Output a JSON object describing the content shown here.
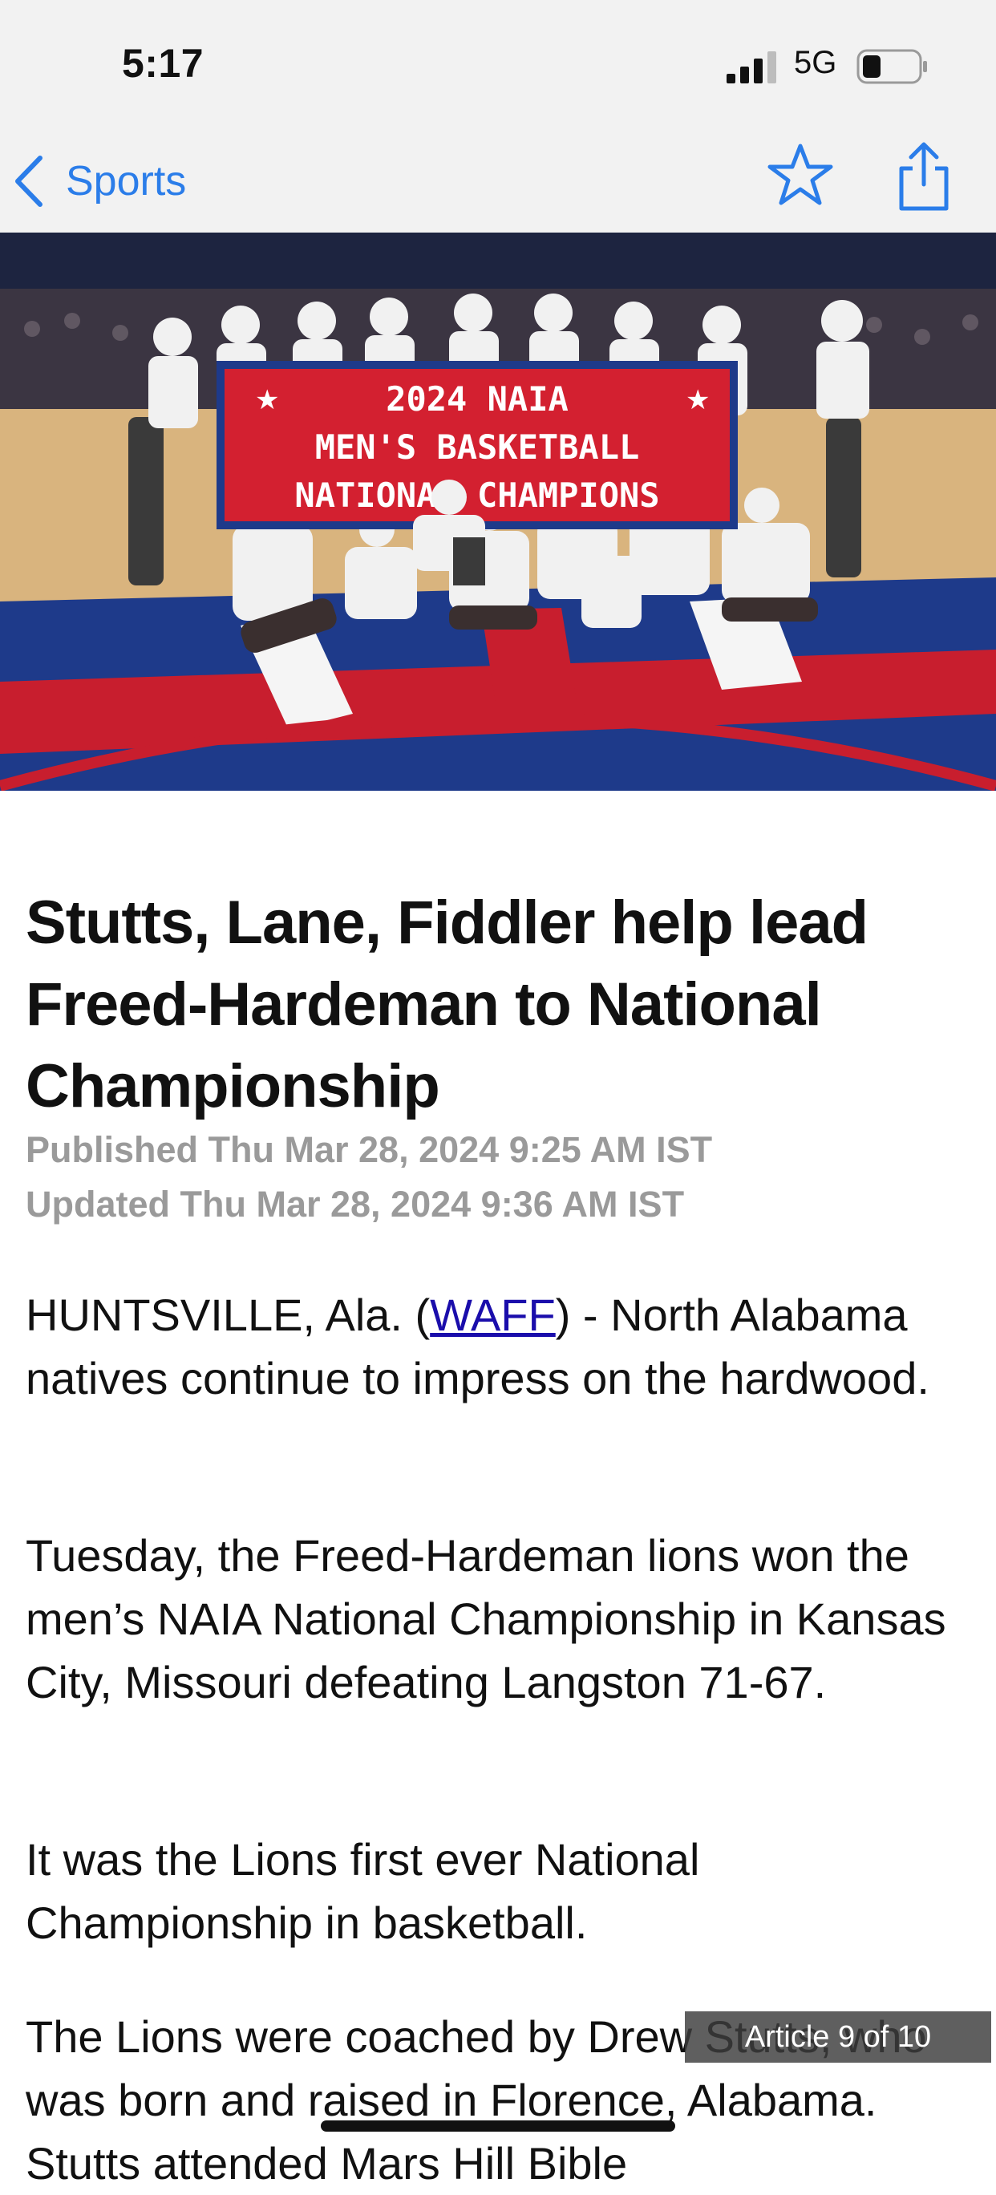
{
  "status_bar": {
    "time": "5:17",
    "network": "5G"
  },
  "nav": {
    "back_label": "Sports"
  },
  "hero": {
    "banner_line1": "2024 NAIA",
    "banner_line2": "MEN'S BASKETBALL",
    "banner_line3": "NATIONAL CHAMPIONS"
  },
  "article": {
    "headline": "Stutts, Lane, Fiddler help lead Freed-Hardeman to National Championship",
    "published": "Published Thu Mar 28, 2024 9:25 AM IST",
    "updated": "Updated Thu Mar 28, 2024 9:36 AM IST",
    "p1_prefix": "HUNTSVILLE, Ala. (",
    "p1_link": "WAFF",
    "p1_suffix": ") - North Alabama natives continue to impress on the hardwood.",
    "p2": "Tuesday, the Freed-Hardeman lions won the men’s NAIA National Championship in Kansas City, Missouri defeating Langston 71-67.",
    "p3": "It was the Lions first ever National Championship in basketball.",
    "p4": "The Lions were coached by Drew Stutts, who was born and raised in Florence, Alabama. Stutts attended Mars Hill Bible"
  },
  "overlay": {
    "article_counter": "Article 9 of 10"
  },
  "colors": {
    "accent": "#2b7de9",
    "link": "#1a0dab",
    "banner_red": "#d32030"
  }
}
